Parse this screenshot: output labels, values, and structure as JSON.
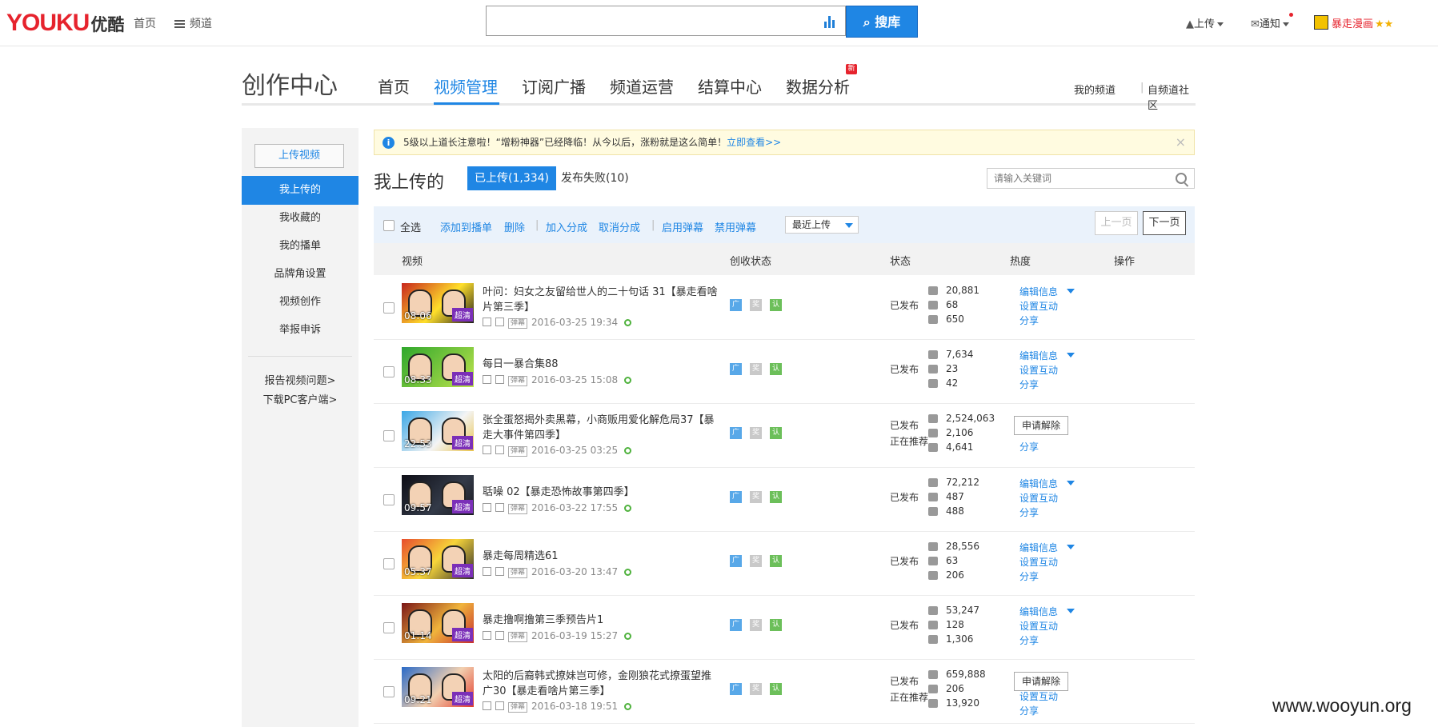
{
  "header": {
    "logo_latin": "YOUKU",
    "logo_cn": "优酷",
    "nav_home": "首页",
    "nav_channel": "频道",
    "search_placeholder": "",
    "search_button": "搜库",
    "upload": "上传",
    "notify": "通知",
    "user": "暴走漫画"
  },
  "studio": {
    "title": "创作中心",
    "nav": [
      "首页",
      "视频管理",
      "订阅广播",
      "频道运营",
      "结算中心",
      "数据分析"
    ],
    "new_badge": "新",
    "my_channel": "我的频道",
    "community": "自频道社区"
  },
  "sidebar": {
    "upload_button": "上传视频",
    "items": [
      "我上传的",
      "我收藏的",
      "我的播单",
      "品牌角设置",
      "视频创作",
      "举报申诉"
    ],
    "links": [
      "报告视频问题>",
      "下载PC客户端>"
    ]
  },
  "notice": {
    "text": "5级以上道长注意啦！“增粉神器”已经降临！从今以后，涨粉就是这么简单！",
    "link": "立即查看>>",
    "close": "×"
  },
  "list": {
    "heading": "我上传的",
    "tab_uploaded": "已上传(1,334)",
    "tab_failed": "发布失败(10)",
    "keyword_placeholder": "请输入关键词",
    "toolbar": {
      "select_all": "全选",
      "add_playlist": "添加到播单",
      "delete": "删除",
      "join_share": "加入分成",
      "cancel_share": "取消分成",
      "enable_danmu": "启用弹幕",
      "disable_danmu": "禁用弹幕",
      "sort": "最近上传",
      "prev": "上一页",
      "next": "下一页"
    },
    "columns": [
      "视频",
      "创收状态",
      "状态",
      "热度",
      "操作"
    ]
  },
  "videos": [
    {
      "duration": "08:06",
      "quality": "超清",
      "title": "叶问：妇女之友留给世人的二十句话 31【暴走看啥片第三季】",
      "date": "2016-03-25 19:34",
      "status": "已发布",
      "status2": "",
      "plays": "20,881",
      "comments": "68",
      "shares": "650",
      "ops": [
        "编辑信息",
        "设置互动",
        "分享"
      ]
    },
    {
      "duration": "08:33",
      "quality": "超清",
      "title": "每日一暴合集88",
      "date": "2016-03-25 15:08",
      "status": "已发布",
      "status2": "",
      "plays": "7,634",
      "comments": "23",
      "shares": "42",
      "ops": [
        "编辑信息",
        "设置互动",
        "分享"
      ]
    },
    {
      "duration": "22:53",
      "quality": "超清",
      "title": "张全蛋怒揭外卖黑幕，小商贩用爱化解危局37【暴走大事件第四季】",
      "date": "2016-03-25 03:25",
      "status": "已发布",
      "status2": "正在推荐",
      "plays": "2,524,063",
      "comments": "2,106",
      "shares": "4,641",
      "apply": "申请解除",
      "ops": [
        "分享"
      ]
    },
    {
      "duration": "09:57",
      "quality": "超清",
      "title": "聒噪 02【暴走恐怖故事第四季】",
      "date": "2016-03-22 17:55",
      "status": "已发布",
      "status2": "",
      "plays": "72,212",
      "comments": "487",
      "shares": "488",
      "ops": [
        "编辑信息",
        "设置互动",
        "分享"
      ]
    },
    {
      "duration": "05:37",
      "quality": "超清",
      "title": "暴走每周精选61",
      "date": "2016-03-20 13:47",
      "status": "已发布",
      "status2": "",
      "plays": "28,556",
      "comments": "63",
      "shares": "206",
      "ops": [
        "编辑信息",
        "设置互动",
        "分享"
      ]
    },
    {
      "duration": "01:14",
      "quality": "超清",
      "title": "暴走撸啊撸第三季预告片1",
      "date": "2016-03-19 15:27",
      "status": "已发布",
      "status2": "",
      "plays": "53,247",
      "comments": "128",
      "shares": "1,306",
      "ops": [
        "编辑信息",
        "设置互动",
        "分享"
      ]
    },
    {
      "duration": "09:21",
      "quality": "超清",
      "title": "太阳的后裔韩式撩妹岂可修，金刚狼花式撩蛋望推广30【暴走看啥片第三季】",
      "date": "2016-03-18 19:51",
      "status": "已发布",
      "status2": "正在推荐",
      "plays": "659,888",
      "comments": "206",
      "shares": "13,920",
      "apply": "申请解除",
      "ops": [
        "设置互动",
        "分享"
      ]
    }
  ],
  "revenue_icons": [
    "广",
    "奖",
    "认"
  ],
  "meta_badge": "弹幕",
  "watermark": "www.wooyun.org",
  "colors": {
    "accent": "#1f86e4",
    "brand_red": "#e6232d",
    "hd_badge": "#7b2fb8"
  }
}
